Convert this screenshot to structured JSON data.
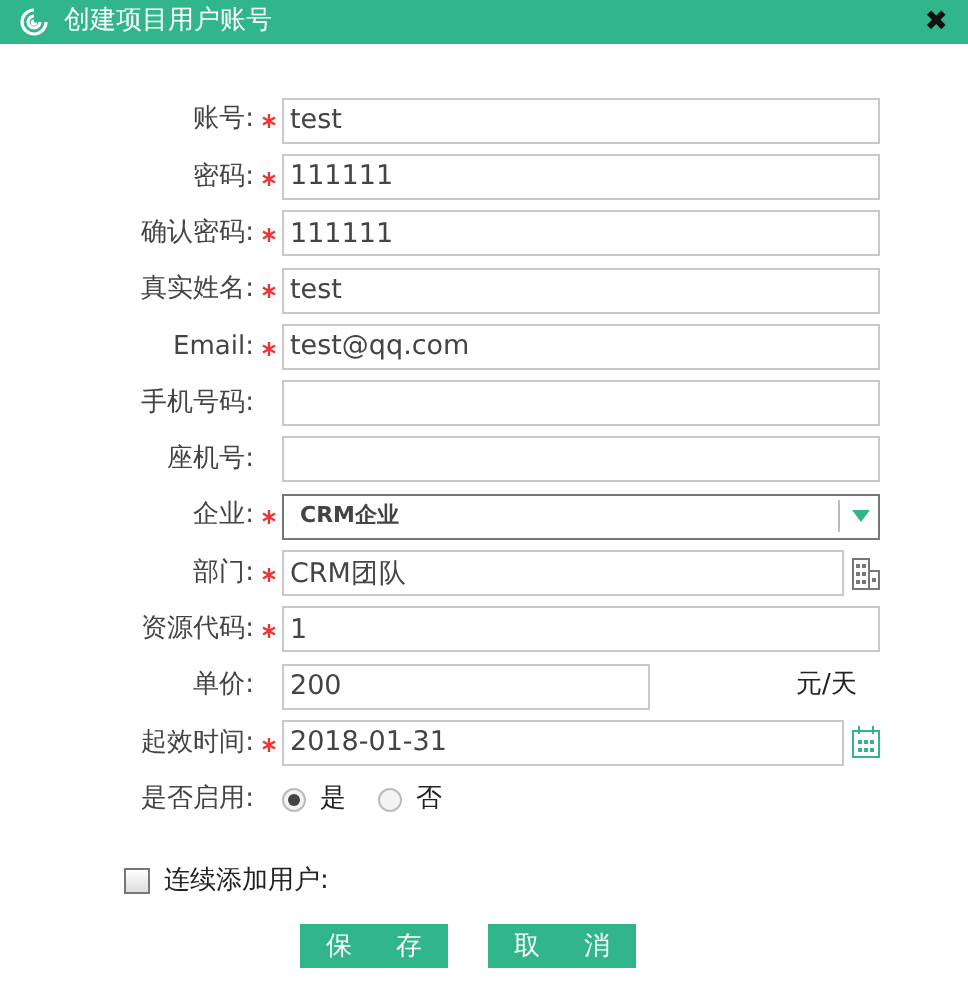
{
  "window": {
    "title": "创建项目用户账号",
    "close": "✖"
  },
  "fields": [
    {
      "label": "账号:",
      "required": true,
      "kind": "text",
      "value": "test"
    },
    {
      "label": "密码:",
      "required": true,
      "kind": "text",
      "value": "111111"
    },
    {
      "label": "确认密码:",
      "required": true,
      "kind": "text",
      "value": "111111"
    },
    {
      "label": "真实姓名:",
      "required": true,
      "kind": "text",
      "value": "test"
    },
    {
      "label": "Email:",
      "required": true,
      "kind": "text",
      "value": "test@qq.com"
    },
    {
      "label": "手机号码:",
      "required": false,
      "kind": "text"
    },
    {
      "label": "座机号:",
      "required": false,
      "kind": "text"
    },
    {
      "label": "企业:",
      "required": true,
      "kind": "select",
      "value": "CRM企业"
    },
    {
      "label": "部门:",
      "required": true,
      "kind": "org",
      "value": "CRM团队"
    },
    {
      "label": "资源代码:",
      "required": true,
      "kind": "text",
      "value": "1"
    },
    {
      "label": "单价:",
      "required": false,
      "kind": "unit",
      "value": "200",
      "unit": "元/天"
    },
    {
      "label": "起效时间:",
      "required": true,
      "kind": "date",
      "value": "2018-01-31"
    }
  ],
  "enabled": {
    "label": "是否启用:",
    "options": [
      {
        "label": "是",
        "selected": true
      },
      {
        "label": "否",
        "selected": false
      }
    ]
  },
  "continuous": {
    "label": "连续添加用户:",
    "checked": false
  },
  "buttons": [
    "保 存",
    "取 消"
  ]
}
